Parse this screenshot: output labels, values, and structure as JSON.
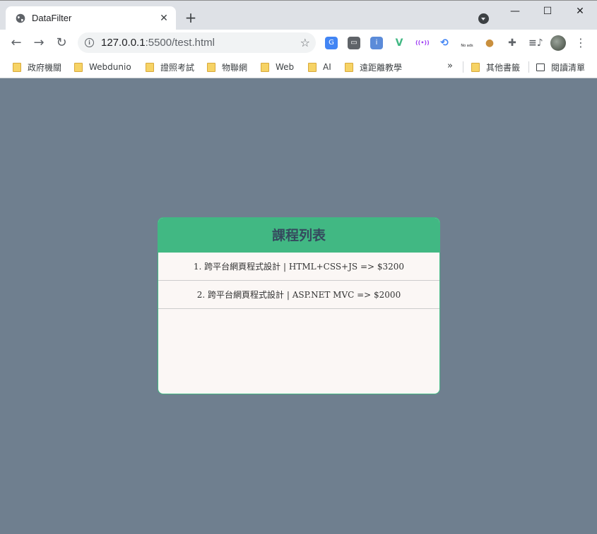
{
  "browser": {
    "tab": {
      "title": "DataFilter",
      "close": "✕"
    },
    "new_tab": "+",
    "window_controls": {
      "minimize": "—",
      "maximize": "☐",
      "close": "✕"
    },
    "address": {
      "url_host": "127.0.0.1",
      "url_rest": ":5500/test.html"
    },
    "extensions": [
      {
        "name": "google-translate-icon",
        "glyph": "G",
        "color": "#4285f4"
      },
      {
        "name": "line-icon",
        "glyph": "▭",
        "color": "#5f6368"
      },
      {
        "name": "info-compass-icon",
        "glyph": "i",
        "color": "#5b8bd9"
      },
      {
        "name": "vue-devtools-icon",
        "glyph": "V",
        "color": "#41b883"
      },
      {
        "name": "broadcast-icon",
        "glyph": "((•))",
        "color": "#a142f4"
      },
      {
        "name": "share-icon",
        "glyph": "⟲",
        "color": "#4285f4"
      },
      {
        "name": "no-ads-icon",
        "glyph": "No ads",
        "color": "#202124"
      },
      {
        "name": "cookie-icon",
        "glyph": "●",
        "color": "#c98f3d"
      },
      {
        "name": "puzzle-extensions-icon",
        "glyph": "✚",
        "color": "#5f6368"
      },
      {
        "name": "media-queue-icon",
        "glyph": "≡♪",
        "color": "#5f6368"
      }
    ]
  },
  "bookmarks": {
    "items": [
      "政府機關",
      "Webdunio",
      "證照考試",
      "物聯網",
      "Web",
      "AI",
      "遠距離教學"
    ],
    "more": "»",
    "other": "其他書籤",
    "reading_list": "閱讀清單"
  },
  "page": {
    "card_title": "課程列表",
    "courses": [
      "1. 跨平台網頁程式設計 | HTML+CSS+JS => $3200",
      "2. 跨平台網頁程式設計 | ASP.NET MVC => $2000"
    ]
  },
  "colors": {
    "page_background": "#6f7f8f",
    "card_header": "#41b883",
    "card_title_text": "#35495e",
    "card_body": "#fbf7f5"
  }
}
